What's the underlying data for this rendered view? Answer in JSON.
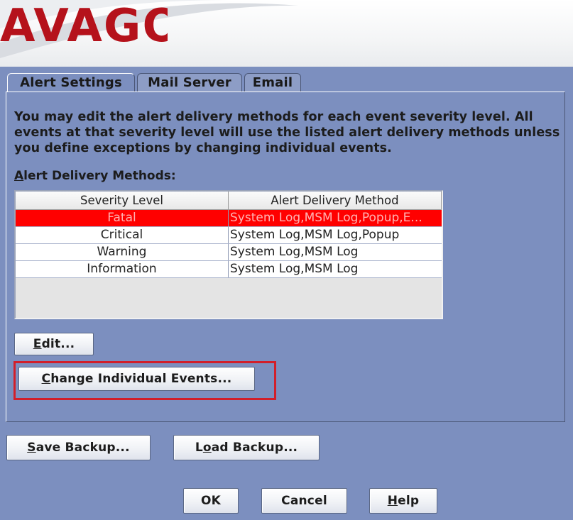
{
  "banner": {
    "brand": "AVAGO"
  },
  "tabs": [
    {
      "label": "Alert Settings",
      "mnemonic": ""
    },
    {
      "label": "Mail Server",
      "mnemonic": ""
    },
    {
      "label": "Email",
      "mnemonic": ""
    }
  ],
  "description": "You may edit the alert delivery methods for each event severity level. All events at that severity level will use the listed alert delivery methods unless you define exceptions by changing individual events.",
  "section_label": {
    "mn": "A",
    "rest": "lert Delivery Methods:"
  },
  "table": {
    "columns": [
      "Severity Level",
      "Alert Delivery Method"
    ],
    "rows": [
      {
        "level": "Fatal",
        "method": "System Log,MSM Log,Popup,E..."
      },
      {
        "level": "Critical",
        "method": "System Log,MSM Log,Popup"
      },
      {
        "level": "Warning",
        "method": "System Log,MSM Log"
      },
      {
        "level": "Information",
        "method": "System Log,MSM Log"
      }
    ],
    "selected_row": "Fatal",
    "selected_color": "#ff0000"
  },
  "buttons": {
    "edit": {
      "mn": "E",
      "rest": "dit..."
    },
    "change_events": {
      "mn": "C",
      "rest": "hange Individual Events..."
    },
    "save_backup": {
      "mn": "S",
      "rest": "ave Backup..."
    },
    "load_backup": {
      "pre": "L",
      "mn": "o",
      "rest": "ad Backup..."
    },
    "ok": "OK",
    "cancel": "Cancel",
    "help": {
      "mn": "H",
      "rest": "elp"
    }
  },
  "colors": {
    "background": "#7c8fbf",
    "brand_red": "#b5121b",
    "highlight": "#d21f2a"
  }
}
